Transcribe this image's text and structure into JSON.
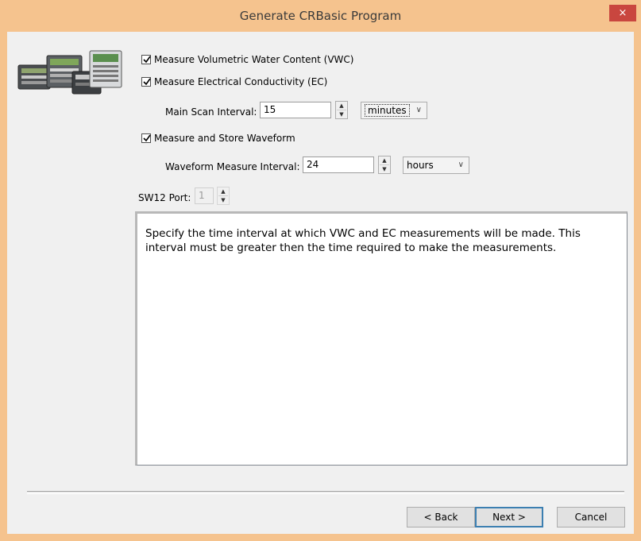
{
  "window": {
    "title": "Generate CRBasic Program",
    "close_label": "×"
  },
  "options": {
    "vwc_label": "Measure Volumetric Water Content (VWC)",
    "vwc_checked": true,
    "ec_label": "Measure Electrical Conductivity (EC)",
    "ec_checked": true,
    "waveform_label": "Measure and Store Waveform",
    "waveform_checked": true
  },
  "scan": {
    "label": "Main Scan Interval:",
    "value": "15",
    "unit": "minutes",
    "unit_caret": "∨"
  },
  "waveform": {
    "label": "Waveform Measure Interval:",
    "value": "24",
    "unit": "hours",
    "unit_caret": "∨"
  },
  "sw12": {
    "label": "SW12 Port:",
    "value": "1"
  },
  "spinner": {
    "up": "▲",
    "down": "▼"
  },
  "help": {
    "text": "Specify the time interval at which VWC and EC measurements will be made. This interval must be greater then the time required to make the measurements."
  },
  "buttons": {
    "back": "< Back",
    "next": "Next >",
    "cancel": "Cancel"
  },
  "colors": {
    "titlebar": "#f5c38e",
    "close": "#c9463f",
    "client": "#f0f0f0",
    "default_button_border": "#3c7fb1"
  },
  "icons": {
    "device_image": "datalogger-devices-image",
    "check": "checkmark-icon"
  }
}
